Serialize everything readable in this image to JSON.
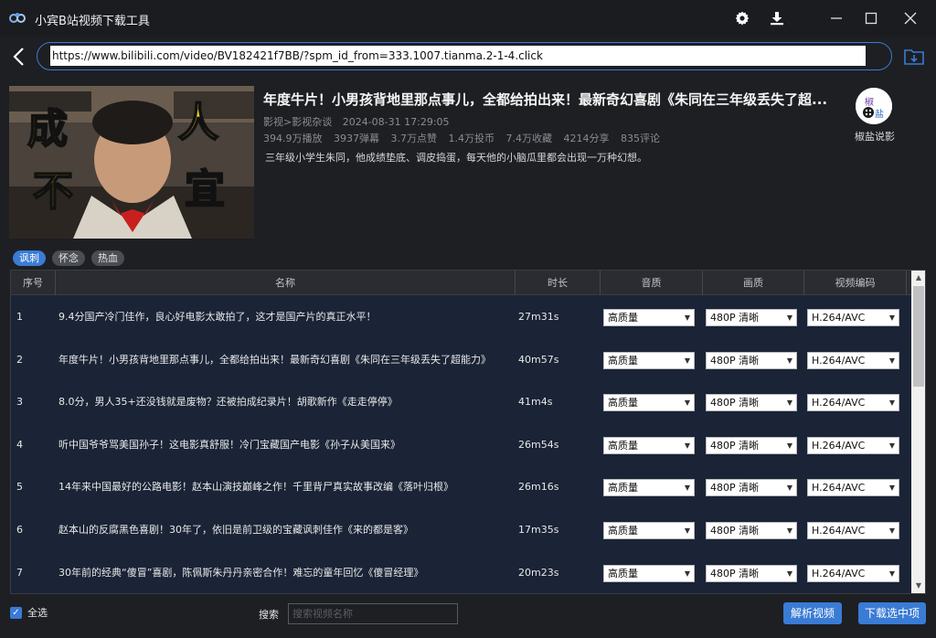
{
  "app": {
    "title": "小宾B站视频下载工具"
  },
  "url": {
    "value": "https://www.bilibili.com/video/BV182421f7BB/?spm_id_from=333.1007.tianma.2-1-4.click"
  },
  "video": {
    "title": "年度牛片！小男孩背地里那点事儿，全都给拍出来！最新奇幻喜剧《朱同在三年级丢失了超...",
    "category": "影视>影视杂谈",
    "date": "2024-08-31 17:29:05",
    "stats": [
      "394.9万播放",
      "3937弹幕",
      "3.7万点赞",
      "1.4万投币",
      "7.4万收藏",
      "4214分享",
      "835评论"
    ],
    "description": "三年级小学生朱同，他成绩垫底、调皮捣蛋，每天他的小脑瓜里都会出现一万种幻想。",
    "thumbnail_text": [
      "成",
      "人",
      "不",
      "宜"
    ],
    "author": "椒盐说影",
    "avatar_text": [
      "椒",
      "盐"
    ]
  },
  "tags": [
    "讽刺",
    "怀念",
    "热血"
  ],
  "table": {
    "headers": [
      "序号",
      "名称",
      "时长",
      "音质",
      "画质",
      "视频编码"
    ],
    "rows": [
      {
        "index": "1",
        "name": "9.4分国产冷门佳作，良心好电影太敢拍了，这才是国产片的真正水平！",
        "duration": "27m31s",
        "audio": "高质量",
        "quality": "480P 清晰",
        "codec": "H.264/AVC"
      },
      {
        "index": "2",
        "name": "年度牛片！小男孩背地里那点事儿，全都给拍出来！最新奇幻喜剧《朱同在三年级丢失了超能力》",
        "duration": "40m57s",
        "audio": "高质量",
        "quality": "480P 清晰",
        "codec": "H.264/AVC"
      },
      {
        "index": "3",
        "name": "8.0分，男人35+还没钱就是废物？还被拍成纪录片！胡歌新作《走走停停》",
        "duration": "41m4s",
        "audio": "高质量",
        "quality": "480P 清晰",
        "codec": "H.264/AVC"
      },
      {
        "index": "4",
        "name": "听中国爷爷骂美国孙子！这电影真舒服！冷门宝藏国产电影《孙子从美国来》",
        "duration": "26m54s",
        "audio": "高质量",
        "quality": "480P 清晰",
        "codec": "H.264/AVC"
      },
      {
        "index": "5",
        "name": "14年来中国最好的公路电影！赵本山演技巅峰之作！千里背尸真实故事改编《落叶归根》",
        "duration": "26m16s",
        "audio": "高质量",
        "quality": "480P 清晰",
        "codec": "H.264/AVC"
      },
      {
        "index": "6",
        "name": "赵本山的反腐黑色喜剧！30年了，依旧是前卫级的宝藏讽刺佳作《来的都是客》",
        "duration": "17m35s",
        "audio": "高质量",
        "quality": "480P 清晰",
        "codec": "H.264/AVC"
      },
      {
        "index": "7",
        "name": "30年前的经典“傻冒”喜剧，陈佩斯朱丹丹亲密合作！难忘的童年回忆《傻冒经理》",
        "duration": "20m23s",
        "audio": "高质量",
        "quality": "480P 清晰",
        "codec": "H.264/AVC"
      }
    ]
  },
  "bottom": {
    "select_all": "全选",
    "search_label": "搜索",
    "search_placeholder": "搜索视频名称",
    "parse_button": "解析视频",
    "download_button": "下载选中项"
  },
  "colors": {
    "accent": "#3a7bd5",
    "background": "#1d1f23",
    "table_bg": "#1a2436"
  }
}
